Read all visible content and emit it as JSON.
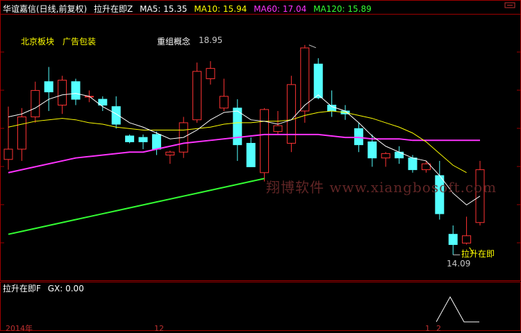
{
  "header": {
    "title": "华谊嘉信(日线,前复权)",
    "indicator": "拉升在即Z",
    "ma": [
      {
        "label": "MA5: 15.35",
        "color": "#ffffff"
      },
      {
        "label": "MA10: 15.94",
        "color": "#ffff00"
      },
      {
        "label": "MA60: 17.04",
        "color": "#ff33ff"
      },
      {
        "label": "MA120: 15.89",
        "color": "#33ff33"
      }
    ]
  },
  "annotations": {
    "beijing": "北京板块",
    "ad": "广告包装",
    "restructure": "重组概念",
    "high_price": "18.95",
    "low_price": "14.09",
    "signal": "拉升在即"
  },
  "watermark": "翔博软件 www.xiangbosoft.com",
  "sub_panel": {
    "label": "拉升在即F",
    "gx": "GX: 0.00"
  },
  "dates": {
    "year": "2014年",
    "month": "12",
    "m1": "1",
    "m2": "2"
  },
  "colors": {
    "up": "#ff3333",
    "down": "#54ffff",
    "ma5": "#ffffff",
    "ma10": "#ffff00",
    "ma60": "#ff33ff",
    "ma120": "#33ff33",
    "frame": "#a00000"
  },
  "candles": [
    [
      14.75,
      15.1,
      16.55,
      14.4
    ],
    [
      15.1,
      16.2,
      16.5,
      14.7
    ],
    [
      16.2,
      17.1,
      17.4,
      16.0
    ],
    [
      17.4,
      17.05,
      17.9,
      16.4
    ],
    [
      16.6,
      17.45,
      17.6,
      16.3
    ],
    [
      17.4,
      16.8,
      17.5,
      16.6
    ],
    [
      16.9,
      16.9,
      17.1,
      16.7
    ],
    [
      16.8,
      16.6,
      16.9,
      16.4
    ],
    [
      16.55,
      15.95,
      16.9,
      15.8
    ],
    [
      15.55,
      15.35,
      15.6,
      15.3
    ],
    [
      15.5,
      15.35,
      15.6,
      15.1
    ],
    [
      15.6,
      15.1,
      15.7,
      14.9
    ],
    [
      14.9,
      15.0,
      15.05,
      14.6
    ],
    [
      15.0,
      16.0,
      16.2,
      14.8
    ],
    [
      16.1,
      17.75,
      18.05,
      16.0
    ],
    [
      17.5,
      17.85,
      18.1,
      17.3
    ],
    [
      16.5,
      16.9,
      17.5,
      16.4
    ],
    [
      16.5,
      15.25,
      16.8,
      14.7
    ],
    [
      15.3,
      14.5,
      15.5,
      14.5
    ],
    [
      14.3,
      16.45,
      16.5,
      14.0
    ],
    [
      15.7,
      15.9,
      16.4,
      15.6
    ],
    [
      15.3,
      17.3,
      17.6,
      15.0
    ],
    [
      16.4,
      18.55,
      18.65,
      16.0
    ],
    [
      18.0,
      16.85,
      18.2,
      16.8
    ],
    [
      16.6,
      16.4,
      17.1,
      16.2
    ],
    [
      16.4,
      16.3,
      16.6,
      16.1
    ],
    [
      15.8,
      15.25,
      16.0,
      15.0
    ],
    [
      15.35,
      14.8,
      15.6,
      14.5
    ],
    [
      14.8,
      14.95,
      15.0,
      14.5
    ],
    [
      15.0,
      14.8,
      15.2,
      14.6
    ],
    [
      14.8,
      14.4,
      14.9,
      14.3
    ],
    [
      14.4,
      14.6,
      14.7,
      14.3
    ],
    [
      14.2,
      12.9,
      14.7,
      12.7
    ],
    [
      12.2,
      11.85,
      12.5,
      11.5
    ],
    [
      11.9,
      12.15,
      12.8,
      11.85
    ],
    [
      12.6,
      14.4,
      14.7,
      12.5
    ]
  ],
  "ma5_line": [
    16.2,
    16.3,
    16.5,
    16.8,
    16.95,
    17.0,
    16.9,
    16.55,
    16.3,
    16.0,
    15.85,
    15.65,
    15.45,
    15.5,
    15.75,
    16.1,
    16.35,
    16.4,
    16.1,
    16.05,
    15.95,
    16.1,
    16.6,
    16.95,
    16.55,
    16.4,
    16.0,
    15.55,
    15.2,
    15.0,
    14.8,
    14.7,
    14.2,
    13.6,
    13.2,
    13.5
  ],
  "ma10_line": [
    15.85,
    15.95,
    16.05,
    16.1,
    16.15,
    16.1,
    16.0,
    15.95,
    15.85,
    15.8,
    15.75,
    15.75,
    15.75,
    15.75,
    15.8,
    15.85,
    15.95,
    16.0,
    16.0,
    16.05,
    16.05,
    16.1,
    16.25,
    16.35,
    16.4,
    16.35,
    16.25,
    16.15,
    16.0,
    15.85,
    15.65,
    15.35,
    14.95,
    14.55,
    14.3
  ],
  "ma60_line": [
    14.3,
    14.4,
    14.5,
    14.6,
    14.7,
    14.8,
    14.85,
    14.9,
    14.95,
    15.0,
    15.0,
    15.1,
    15.2,
    15.3,
    15.35,
    15.4,
    15.45,
    15.5,
    15.55,
    15.6,
    15.6,
    15.6,
    15.6,
    15.6,
    15.55,
    15.5,
    15.5,
    15.45,
    15.45,
    15.45,
    15.4,
    15.4,
    15.4,
    15.4,
    15.4,
    15.4
  ],
  "ma120_line": [
    12.2,
    12.3,
    12.4,
    12.5,
    12.6,
    12.7,
    12.8,
    12.9,
    13.0,
    13.1,
    13.2,
    13.3,
    13.4,
    13.5,
    13.6,
    13.7,
    13.8,
    13.9,
    14.0,
    14.1
  ]
}
